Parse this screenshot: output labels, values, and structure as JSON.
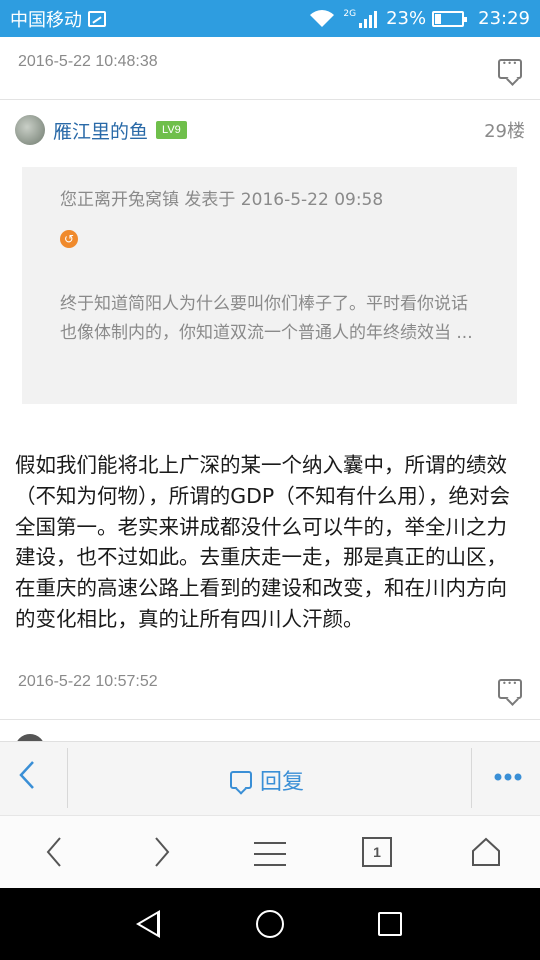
{
  "status_bar": {
    "carrier": "中国移动",
    "network": "2G",
    "battery": "23%",
    "time": "23:29"
  },
  "prev_post": {
    "timestamp": "2016-5-22 10:48:38"
  },
  "post": {
    "username": "雁江里的鱼",
    "level": "LV9",
    "floor": "29楼",
    "quote": {
      "author_line": "您正离开兔窝镇 发表于 2016-5-22 09:58",
      "text": "终于知道简阳人为什么要叫你们棒子了。平时看你说话也像体制内的，你知道双流一个普通人的年终绩效当 ..."
    },
    "body": "假如我们能将北上广深的某一个纳入囊中，所谓的绩效（不知为何物），所谓的GDP（不知有什么用），绝对会全国第一。老实来讲成都没什么可以牛的，举全川之力建设，也不过如此。去重庆走一走，那是真正的山区，在重庆的高速公路上看到的建设和改变，和在川内方向的变化相比，真的让所有四川人汗颜。",
    "timestamp": "2016-5-22 10:57:52"
  },
  "reply_bar": {
    "back_icon": "chevron-left-icon",
    "reply_label": "回复",
    "more_icon": "more-dots-icon"
  },
  "browser_bar": {
    "tab_count": "1"
  },
  "colors": {
    "status_bar": "#2e9de0",
    "accent": "#3a8fd6",
    "username": "#2a6aa8",
    "level_badge": "#6fbf4b"
  }
}
